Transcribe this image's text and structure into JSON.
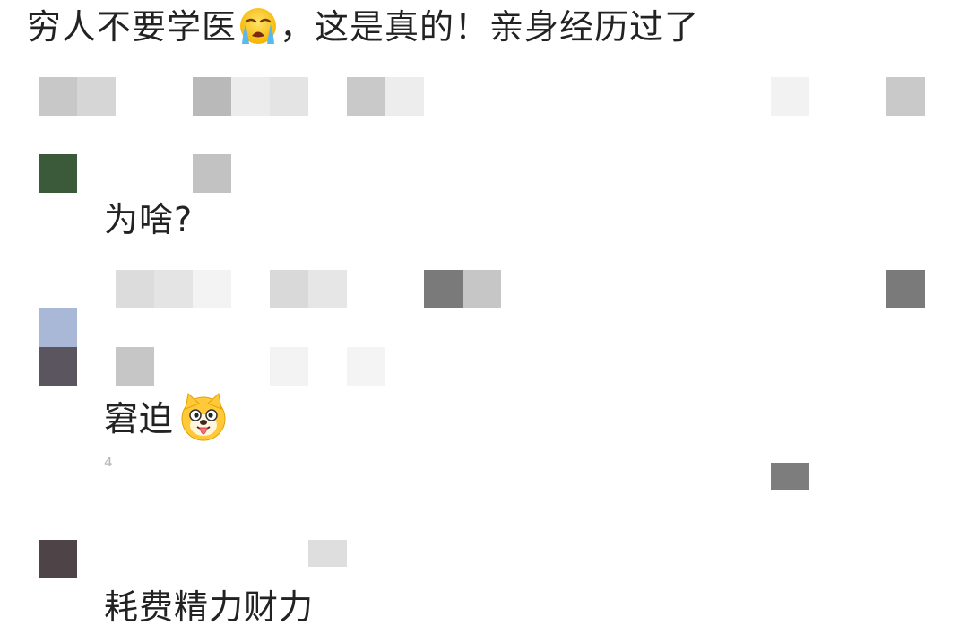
{
  "post": {
    "text_before_emoji": "穷人不要学医",
    "emoji_icon": "crying-face-icon",
    "text_after_emoji": "，这是真的！亲身经历过了"
  },
  "replies": [
    {
      "text": "为啥?",
      "emoji_icon": ""
    },
    {
      "text": "窘迫",
      "emoji_icon": "shiba-dog-tongue-icon"
    },
    {
      "text": "耗费精力财力",
      "emoji_icon": ""
    }
  ],
  "colors": {
    "avatar_1": "#3b5a3a",
    "avatar_2_top": "#a9b8d6",
    "avatar_2_bottom": "#5b5560",
    "avatar_3": "#4e4347",
    "mosaic_light": "#e6e6e6",
    "mosaic_mid": "#c4c4c4",
    "mosaic_dark": "#7a7a7a"
  }
}
